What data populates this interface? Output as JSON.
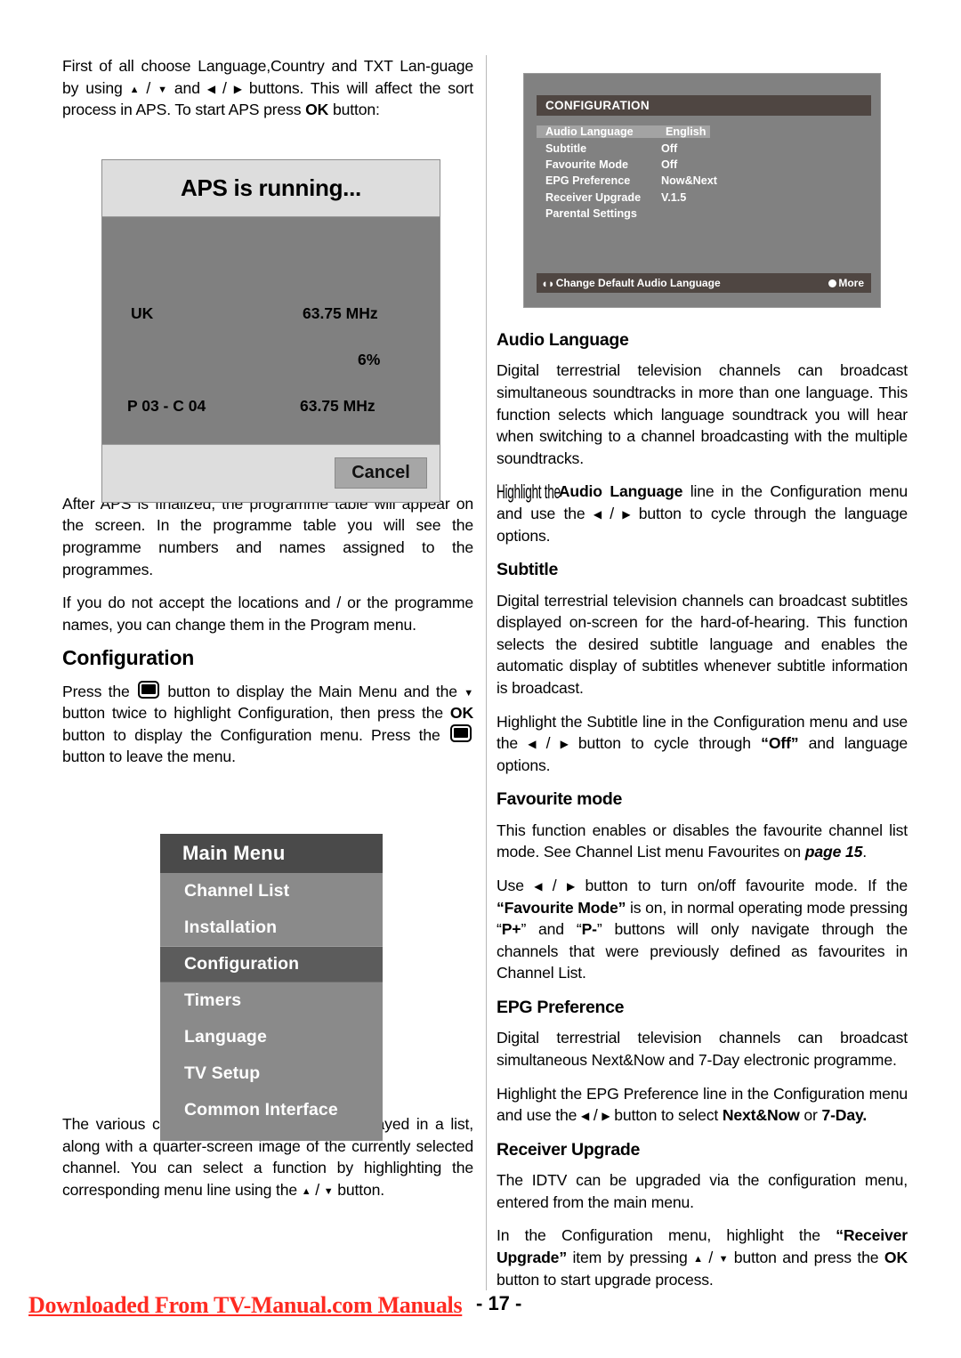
{
  "document": {
    "page_number": "- 17 -",
    "watermark": "Downloaded From TV-Manual.com Manuals",
    "watermark_color": "#ff2a21"
  },
  "left_column": {
    "intro_paragraph": {
      "part1": "First of all choose Language,Country and TXT Lan-guage by using ",
      "part2": " / ",
      "part3": " and ",
      "part4": " / ",
      "part5": " buttons. This will affect the sort process in APS. To start APS press ",
      "bold_ok": "OK",
      "part6": " button:"
    },
    "after_aps_paragraph": "After APS is finalized, the programme table will appear on the screen. In the programme table you will see the programme numbers and names assigned to the programmes.",
    "change_names_paragraph": "If you do not accept the locations and / or the programme names, you can change them in the Program menu.",
    "configuration_heading": "Configuration",
    "configuration_paragraph": {
      "part1": "Press the ",
      "part2": " button to display the Main Menu and the ",
      "part3": " button twice to highlight Configuration, then press the ",
      "bold_ok": "OK",
      "part4": " button to display the Configuration menu. Press the ",
      "part5": " button to leave the menu."
    },
    "functions_paragraph": {
      "part1": "The various configuration functions are displayed in a list, along with a quarter-screen image of the currently selected channel. You can select a function by highlighting the corresponding menu line using the ",
      "part2": " / ",
      "part3": " button."
    }
  },
  "aps_dialog": {
    "title": "APS is running...",
    "country": "UK",
    "frequency_top": "63.75 MHz",
    "percent": "6%",
    "programme": "P 03 - C 04",
    "frequency_bottom": "63.75 MHz",
    "cancel_label": "Cancel"
  },
  "main_menu": {
    "title": "Main Menu",
    "items": [
      {
        "label": "Channel List",
        "selected": false
      },
      {
        "label": "Installation",
        "selected": false
      },
      {
        "label": "Configuration",
        "selected": true
      },
      {
        "label": "Timers",
        "selected": false
      },
      {
        "label": "Language",
        "selected": false
      },
      {
        "label": "TV Setup",
        "selected": false
      },
      {
        "label": "Common Interface",
        "selected": false
      }
    ]
  },
  "configuration_osd": {
    "title": "CONFIGURATION",
    "rows": [
      {
        "key": "Audio Language",
        "value": "English",
        "selected": true
      },
      {
        "key": "Subtitle",
        "value": "Off",
        "selected": false
      },
      {
        "key": "Favourite Mode",
        "value": "Off",
        "selected": false
      },
      {
        "key": "EPG Preference",
        "value": "Now&Next",
        "selected": false
      },
      {
        "key": "Receiver Upgrade",
        "value": "V.1.5",
        "selected": false
      },
      {
        "key": "Parental Settings",
        "value": "",
        "selected": false
      }
    ],
    "status_hint": "Change Default Audio Language",
    "status_more": "More"
  },
  "right_column": {
    "audio_language": {
      "heading": "Audio Language",
      "paragraph1": "Digital terrestrial television channels can broadcast simultaneous soundtracks in more than one language. This function selects which language soundtrack you will hear when switching to a channel broadcasting with the multiple soundtracks.",
      "paragraph2": {
        "squished": "Highlight the",
        "bold": "Audio Language",
        "part1": " line in the Configuration menu and use the ",
        "part2": " / ",
        "part3": " button to cycle through the language options."
      }
    },
    "subtitle": {
      "heading": "Subtitle",
      "paragraph1": "Digital terrestrial television channels can broadcast subtitles displayed on-screen for the hard-of-hearing. This function selects the desired subtitle language and enables the automatic display of subtitles whenever subtitle information is broadcast.",
      "paragraph2": {
        "part1": "Highlight the Subtitle line in the Configuration menu and use the ",
        "part2": " / ",
        "part3": " button to cycle through ",
        "bold_off": "“Off”",
        "part4": " and language options."
      }
    },
    "favourite_mode": {
      "heading": "Favourite mode",
      "paragraph1": {
        "part1": "This function enables or disables the favourite channel list mode. See Channel List menu Favourites on ",
        "italic_page": "page 15",
        "part2": "."
      },
      "paragraph2": {
        "part1": "Use ",
        "part2": " / ",
        "part3": " button to turn on/off favourite mode. If the ",
        "bold1": "“Favourite Mode”",
        "part4": " is on, in normal operating mode pressing ",
        "quote_pplus_open": "“",
        "bold2": "P+",
        "quote_pplus_close": "”",
        "part5": " and ",
        "bold3": "P-",
        "part6": " buttons will only navigate through the channels that were previously defined as favourites in Channel List."
      }
    },
    "epg_preference": {
      "heading": "EPG Preference",
      "paragraph1": "Digital terrestrial television channels can broadcast simultaneous Next&Now and 7-Day electronic programme.",
      "paragraph2": {
        "part1": "Highlight the EPG Preference line in the Configuration menu and use the ",
        "part2": " / ",
        "part3": " button to select ",
        "bold1": "Next&Now",
        "part4": " or ",
        "bold2": "7-Day",
        "part5": "."
      }
    },
    "receiver_upgrade": {
      "heading": "Receiver Upgrade",
      "paragraph1": "The IDTV can be upgraded via the configuration menu, entered from the main menu.",
      "paragraph2": {
        "part1": "In the Configuration menu, highlight the ",
        "bold1": "“Receiver Upgrade”",
        "part2": " item by pressing ",
        "part3": " / ",
        "part4": " button and press the ",
        "bold2": "OK",
        "part5": " button to start upgrade process."
      }
    }
  }
}
